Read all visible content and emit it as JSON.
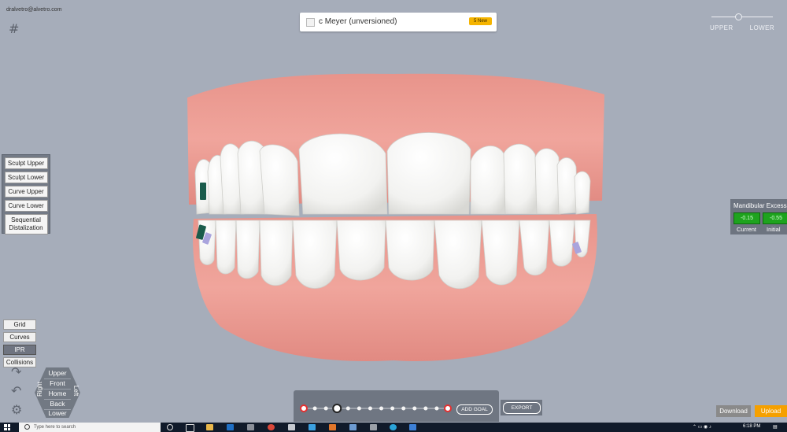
{
  "user": {
    "email": "dralvetro@alvetro.com"
  },
  "header": {
    "patient": "c Meyer (unversioned)",
    "badge": "5 New"
  },
  "arch_toggle": {
    "upper_label": "UPPER",
    "lower_label": "LOWER"
  },
  "sculpt_tools": [
    {
      "label": "Sculpt Upper"
    },
    {
      "label": "Sculpt Lower"
    },
    {
      "label": "Curve Upper"
    },
    {
      "label": "Curve Lower"
    },
    {
      "label": "Sequential\nDistalization"
    }
  ],
  "view_toggles": [
    {
      "label": "Grid",
      "active": false
    },
    {
      "label": "Curves",
      "active": false
    },
    {
      "label": "IPR",
      "active": true
    },
    {
      "label": "Collisions",
      "active": false
    }
  ],
  "view_pad": {
    "upper": "Upper",
    "front": "Front",
    "home": "Home",
    "back": "Back",
    "lower": "Lower",
    "right": "Right",
    "left": "Left"
  },
  "measurement": {
    "title": "Mandibular Excess",
    "current_value": "-0.15",
    "initial_value": "-0.55",
    "current_label": "Current",
    "initial_label": "Initial"
  },
  "timeline": {
    "add_goal_label": "ADD GOAL",
    "export_label": "EXPORT",
    "stage_count": 14,
    "current_stage": 3
  },
  "actions": {
    "download_label": "Download",
    "upload_label": "Upload"
  },
  "taskbar": {
    "search_placeholder": "Type here to search",
    "time": "6:18 PM"
  },
  "colors": {
    "background": "#a6adba",
    "gingiva": "#ec9c94",
    "teeth": "#f7f7f7",
    "accent": "#f5a000",
    "measurement_green": "#1ea31e"
  },
  "icons": [
    "grid-hash-icon",
    "redo-icon",
    "undo-icon",
    "settings-gear-icon",
    "windows-start-icon",
    "search-icon"
  ]
}
